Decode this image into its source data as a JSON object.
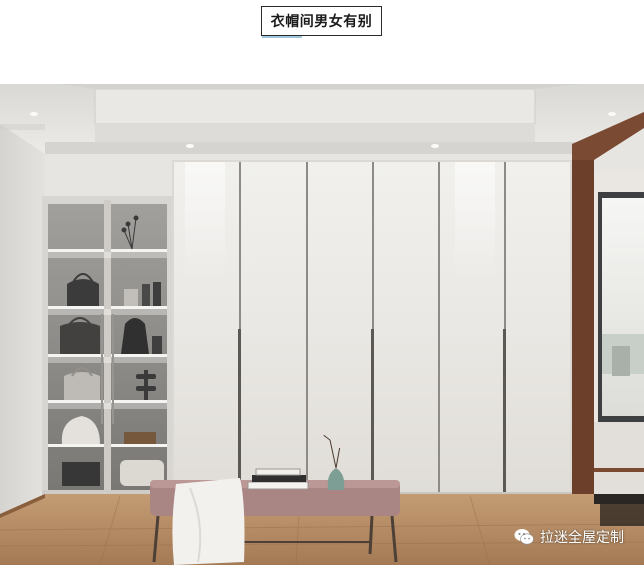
{
  "caption": {
    "title": "衣帽间男女有别"
  },
  "photo": {
    "watermark_text": "拉迷全屋定制",
    "watermark_icon": "wechat-icon",
    "colors": {
      "wall": "#e7e5e1",
      "ceiling": "#e3e2de",
      "wardrobe": "#ebe9e6",
      "floor": "#b38a63",
      "bench_seat": "#a98583",
      "wood_trim": "#6b3f2a"
    }
  }
}
